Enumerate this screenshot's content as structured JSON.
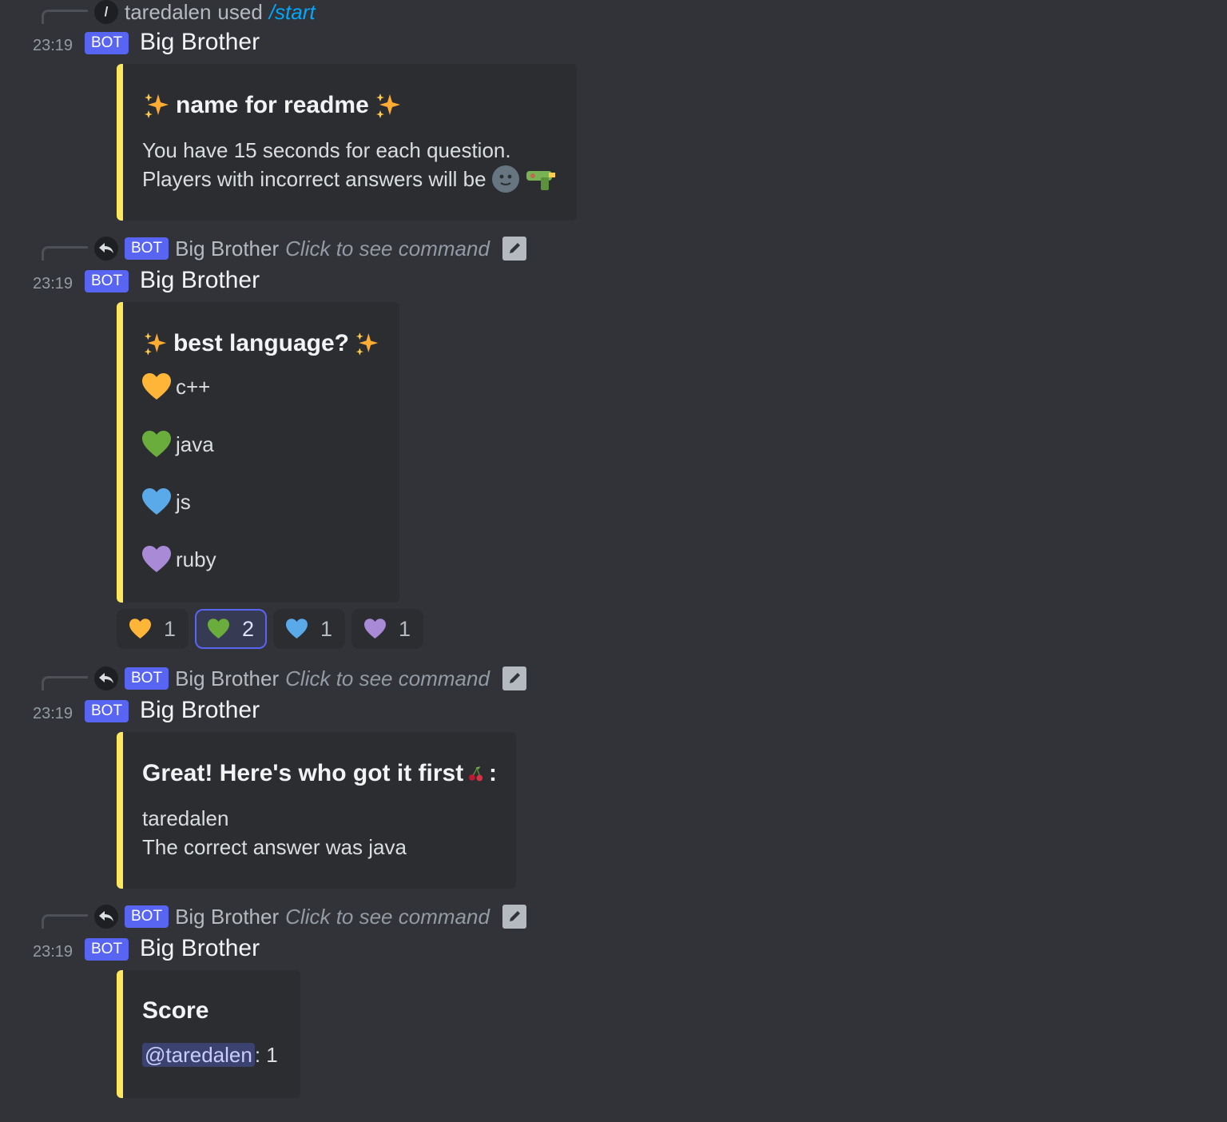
{
  "messages": [
    {
      "context": {
        "user": "taredalen",
        "used": "used",
        "command": "/start"
      },
      "time": "23:19",
      "bot_tag": "BOT",
      "author": "Big Brother",
      "embed": {
        "title": "name for readme",
        "lines": [
          "You have 15 seconds for each question.",
          "Players with incorrect answers will be"
        ],
        "emoji_after": [
          "new-moon-face-icon",
          "water-pistol-icon"
        ]
      }
    },
    {
      "context": {
        "bot_tag": "BOT",
        "author": "Big Brother",
        "click_text": "Click to see command"
      },
      "time": "23:19",
      "bot_tag": "BOT",
      "author": "Big Brother",
      "embed": {
        "title": "best language?",
        "options": [
          {
            "icon": "orange-heart-icon",
            "color": "#ffb638",
            "label": "c++"
          },
          {
            "icon": "green-heart-icon",
            "color": "#6aad3c",
            "label": "java"
          },
          {
            "icon": "blue-heart-icon",
            "color": "#5aa9e8",
            "label": "js"
          },
          {
            "icon": "purple-heart-icon",
            "color": "#a98ad6",
            "label": "ruby"
          }
        ]
      },
      "reactions": [
        {
          "icon": "orange-heart-icon",
          "color": "#ffb638",
          "count": "1",
          "active": false
        },
        {
          "icon": "green-heart-icon",
          "color": "#6aad3c",
          "count": "2",
          "active": true
        },
        {
          "icon": "blue-heart-icon",
          "color": "#5aa9e8",
          "count": "1",
          "active": false
        },
        {
          "icon": "purple-heart-icon",
          "color": "#a98ad6",
          "count": "1",
          "active": false
        }
      ]
    },
    {
      "context": {
        "bot_tag": "BOT",
        "author": "Big Brother",
        "click_text": "Click to see command"
      },
      "time": "23:19",
      "bot_tag": "BOT",
      "author": "Big Brother",
      "embed": {
        "title": "Great! Here's who got it first",
        "title_suffix": ":",
        "title_emoji": "cherries-icon",
        "lines": [
          "taredalen",
          "The correct answer was java"
        ]
      }
    },
    {
      "context": {
        "bot_tag": "BOT",
        "author": "Big Brother",
        "click_text": "Click to see command"
      },
      "time": "23:19",
      "bot_tag": "BOT",
      "author": "Big Brother",
      "embed": {
        "title": "Score",
        "mention": "@taredalen",
        "score_suffix": ": 1"
      }
    }
  ],
  "colors": {
    "embed_accent": "#fee75c",
    "bot_tag": "#5865f2",
    "background": "#313338",
    "embed_bg": "#2b2d31"
  }
}
